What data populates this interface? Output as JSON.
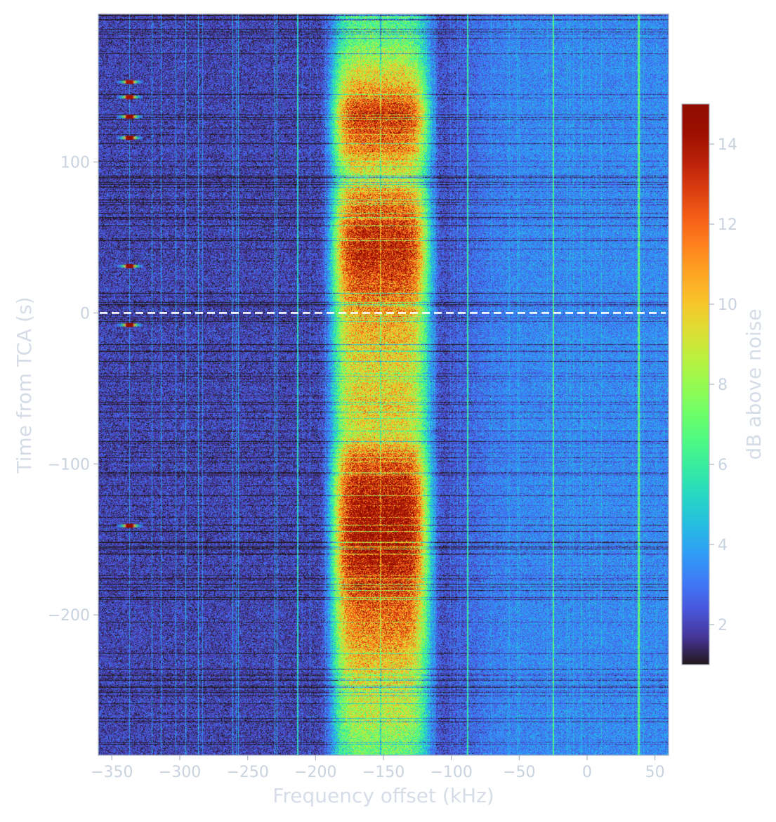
{
  "chart_data": {
    "type": "heatmap",
    "title": "",
    "xlabel": "Frequency offset (kHz)",
    "ylabel": "Time from TCA (s)",
    "xlim": [
      -360,
      60
    ],
    "ylim": [
      -293,
      198
    ],
    "x_ticks": [
      -350,
      -300,
      -250,
      -200,
      -150,
      -100,
      -50,
      0,
      50
    ],
    "y_ticks": [
      -200,
      -100,
      0,
      100
    ],
    "x_tick_labels": [
      "−350",
      "−300",
      "−250",
      "−200",
      "−150",
      "−100",
      "−50",
      "0",
      "50"
    ],
    "y_tick_labels": [
      "−200",
      "−100",
      "0",
      "100"
    ],
    "colormap": "turbo",
    "colorbar": {
      "label": "dB above noise",
      "range": [
        1,
        15
      ],
      "ticks": [
        2,
        4,
        6,
        8,
        10,
        12,
        14
      ],
      "tick_labels": [
        "2",
        "4",
        "6",
        "8",
        "10",
        "12",
        "14"
      ]
    },
    "noise_floor_db": {
      "left_of_signal": 2.0,
      "right_of_signal": 3.4
    },
    "signal_band": {
      "center_khz": -152,
      "width_khz": 70,
      "intensity_db_by_time": [
        [
          -293,
          7
        ],
        [
          -270,
          8.5
        ],
        [
          -250,
          9
        ],
        [
          -230,
          10
        ],
        [
          -210,
          11.5
        ],
        [
          -190,
          12.5
        ],
        [
          -170,
          14
        ],
        [
          -150,
          14.8
        ],
        [
          -130,
          14.5
        ],
        [
          -110,
          13.5
        ],
        [
          -95,
          12
        ],
        [
          -80,
          9
        ],
        [
          -60,
          10
        ],
        [
          -40,
          9.5
        ],
        [
          -20,
          10
        ],
        [
          0,
          11
        ],
        [
          20,
          12.5
        ],
        [
          40,
          14
        ],
        [
          60,
          13
        ],
        [
          80,
          11
        ],
        [
          90,
          8.5
        ],
        [
          110,
          11.5
        ],
        [
          130,
          13.5
        ],
        [
          150,
          10.5
        ],
        [
          170,
          8
        ],
        [
          190,
          6.5
        ]
      ]
    },
    "spurs_khz": [
      -213,
      -88,
      -25,
      38
    ],
    "bursts": [
      {
        "freq_khz": -337,
        "time_s": 153,
        "db": 14
      },
      {
        "freq_khz": -337,
        "time_s": 143,
        "db": 14
      },
      {
        "freq_khz": -337,
        "time_s": 130,
        "db": 15
      },
      {
        "freq_khz": -337,
        "time_s": 116,
        "db": 15
      },
      {
        "freq_khz": -337,
        "time_s": 31,
        "db": 15
      },
      {
        "freq_khz": -337,
        "time_s": -8,
        "db": 15
      },
      {
        "freq_khz": -337,
        "time_s": -141,
        "db": 15
      }
    ],
    "reference_line": {
      "time_s": 0,
      "style": "dashed",
      "color": "#ffffff"
    }
  }
}
